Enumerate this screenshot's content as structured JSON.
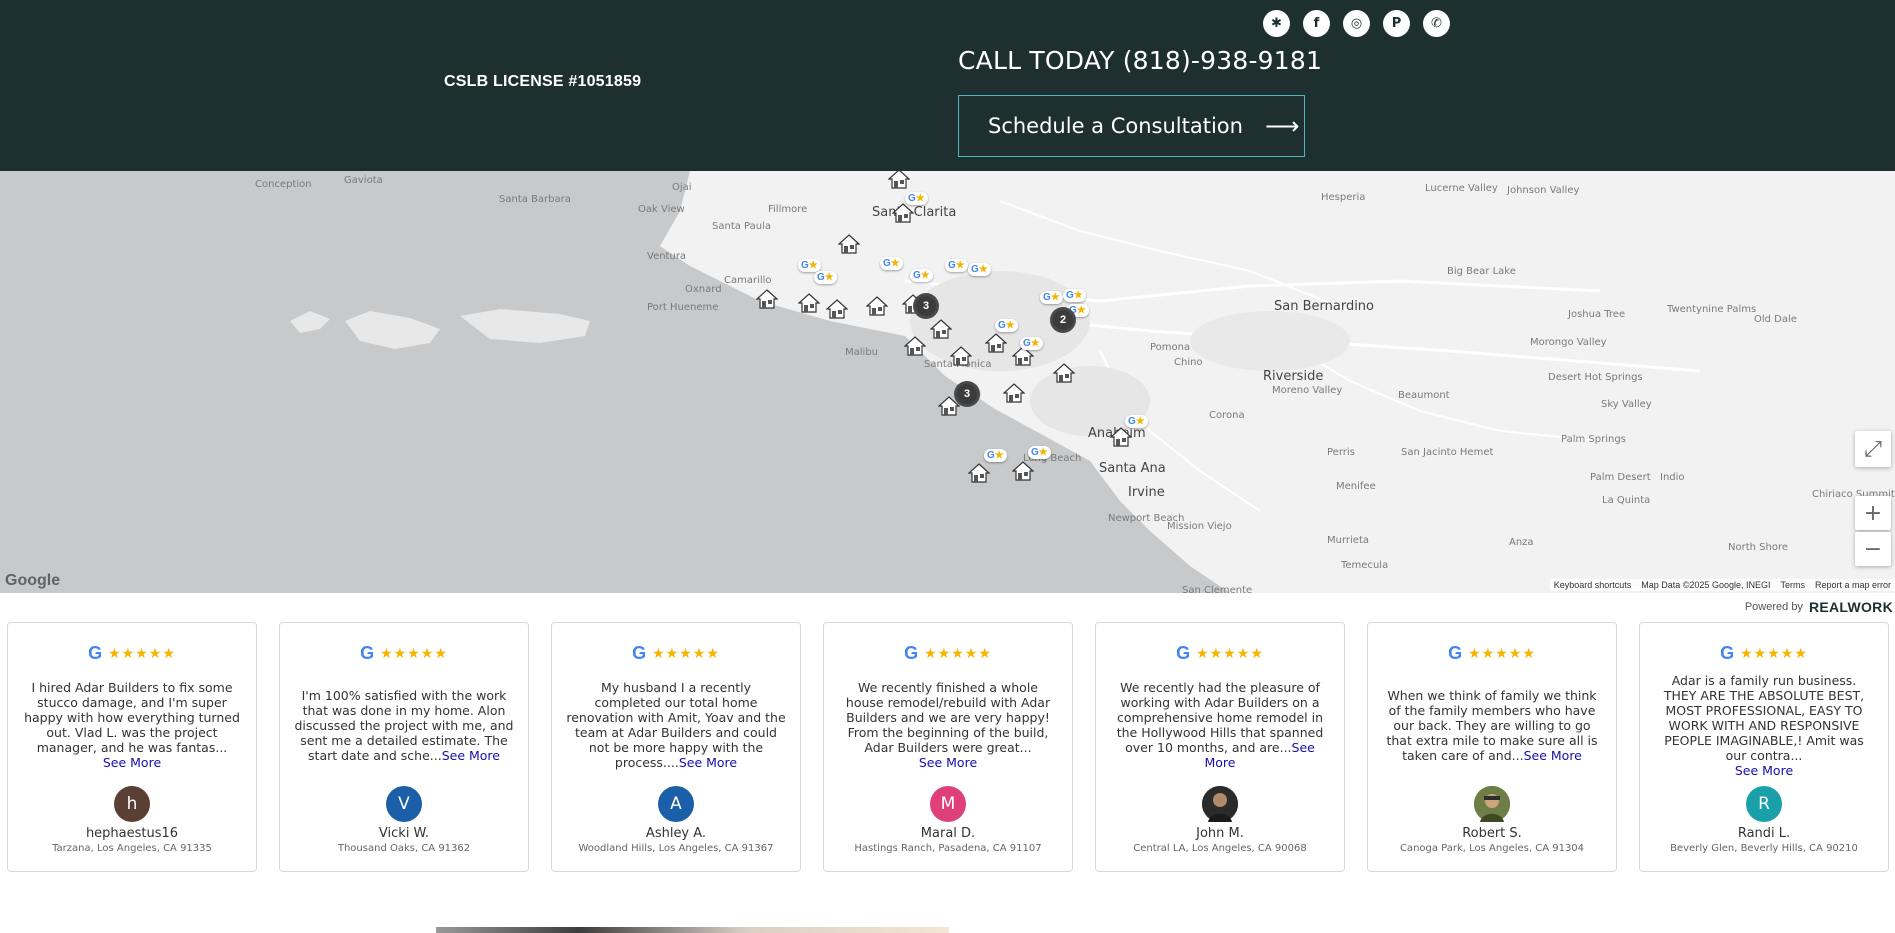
{
  "header": {
    "license": "CSLB LICENSE #1051859",
    "call": "CALL TODAY (818)-938-9181",
    "cta_label": "Schedule a Consultation",
    "cta_arrow": "⟶",
    "social": [
      {
        "name": "yelp-icon",
        "glyph": "✱"
      },
      {
        "name": "facebook-icon",
        "glyph": "f"
      },
      {
        "name": "instagram-icon",
        "glyph": "◎"
      },
      {
        "name": "pinterest-icon",
        "glyph": "P"
      },
      {
        "name": "phone-icon",
        "glyph": "✆"
      }
    ]
  },
  "map": {
    "labels": [
      {
        "text": "Conception",
        "size": "small"
      },
      {
        "text": "Gaviota",
        "size": "small"
      },
      {
        "text": "Ojai",
        "size": "small"
      },
      {
        "text": "Santa Barbara",
        "size": "small"
      },
      {
        "text": "Oak View",
        "size": "small"
      },
      {
        "text": "Fillmore",
        "size": "small"
      },
      {
        "text": "Santa Paula",
        "size": "small"
      },
      {
        "text": "Santa Clarita",
        "size": "big"
      },
      {
        "text": "Ventura",
        "size": "small"
      },
      {
        "text": "Camarillo",
        "size": "small"
      },
      {
        "text": "Oxnard",
        "size": "small"
      },
      {
        "text": "Port Hueneme",
        "size": "small"
      },
      {
        "text": "Malibu",
        "size": "small"
      },
      {
        "text": "Santa Monica",
        "size": "small"
      },
      {
        "text": "Hesperia",
        "size": "small"
      },
      {
        "text": "Lucerne Valley",
        "size": "small"
      },
      {
        "text": "Johnson Valley",
        "size": "small"
      },
      {
        "text": "Big Bear Lake",
        "size": "small"
      },
      {
        "text": "San Bernardino",
        "size": "big"
      },
      {
        "text": "Joshua Tree",
        "size": "small"
      },
      {
        "text": "Twentynine Palms",
        "size": "small"
      },
      {
        "text": "Old Dale",
        "size": "small"
      },
      {
        "text": "Morongo Valley",
        "size": "small"
      },
      {
        "text": "Pomona",
        "size": "small"
      },
      {
        "text": "Chino",
        "size": "small"
      },
      {
        "text": "Riverside",
        "size": "big"
      },
      {
        "text": "Moreno Valley",
        "size": "small"
      },
      {
        "text": "Beaumont",
        "size": "small"
      },
      {
        "text": "Desert Hot Springs",
        "size": "small"
      },
      {
        "text": "Sky Valley",
        "size": "small"
      },
      {
        "text": "Corona",
        "size": "small"
      },
      {
        "text": "Anaheim",
        "size": "big"
      },
      {
        "text": "Santa Ana",
        "size": "big"
      },
      {
        "text": "Irvine",
        "size": "big"
      },
      {
        "text": "Perris",
        "size": "small"
      },
      {
        "text": "San Jacinto Hemet",
        "size": "small"
      },
      {
        "text": "Palm Springs",
        "size": "small"
      },
      {
        "text": "Menifee",
        "size": "small"
      },
      {
        "text": "Palm Desert",
        "size": "small"
      },
      {
        "text": "Indio",
        "size": "small"
      },
      {
        "text": "Newport Beach",
        "size": "small"
      },
      {
        "text": "Mission Viejo",
        "size": "small"
      },
      {
        "text": "La Quinta",
        "size": "small"
      },
      {
        "text": "Murrieta",
        "size": "small"
      },
      {
        "text": "Anza",
        "size": "small"
      },
      {
        "text": "North Shore",
        "size": "small"
      },
      {
        "text": "Chiriaco Summit",
        "size": "small"
      },
      {
        "text": "Temecula",
        "size": "small"
      },
      {
        "text": "San Clemente",
        "size": "small"
      },
      {
        "text": "Long Beach",
        "size": "small"
      }
    ],
    "clusters": [
      "3",
      "2",
      "3"
    ],
    "google_logo": "Google",
    "footer": {
      "shortcuts": "Keyboard shortcuts",
      "data": "Map Data ©2025 Google, INEGI",
      "terms": "Terms",
      "report": "Report a map error"
    },
    "controls": {
      "fullscreen": "⤢",
      "zoom_in": "+",
      "zoom_out": "−"
    }
  },
  "powered": {
    "label": "Powered by",
    "brand": "REALWORK"
  },
  "reviews": [
    {
      "text": "I hired Adar Builders to fix some stucco damage, and I'm super happy with how everything turned out. Vlad L. was the project manager, and he was fantas...",
      "more": "See More",
      "initial": "h",
      "avatar_color": "#5a4034",
      "name": "hephaestus16",
      "location": "Tarzana, Los Angeles, CA 91335"
    },
    {
      "text": "I'm 100% satisfied with the work that was done in my home. Alon discussed the project with me, and sent me a detailed estimate. The start date and sche...",
      "more": "See More",
      "initial": "V",
      "avatar_color": "#1a5fa8",
      "name": "Vicki W.",
      "location": "Thousand Oaks, CA 91362"
    },
    {
      "text": "My husband I a recently completed our total home renovation with Amit, Yoav and the team at Adar Builders and could not be more happy with the process....",
      "more": "See More",
      "initial": "A",
      "avatar_color": "#1a5fa8",
      "name": "Ashley A.",
      "location": "Woodland Hills, Los Angeles, CA 91367"
    },
    {
      "text": "We recently finished a whole house remodel/rebuild with Adar Builders and we are very happy! From the beginning of the build, Adar Builders were great...",
      "more": "See More",
      "initial": "M",
      "avatar_color": "#e0407a",
      "name": "Maral D.",
      "location": "Hastings Ranch, Pasadena, CA 91107"
    },
    {
      "text": "We recently had the pleasure of working with Adar Builders on a comprehensive home remodel in the Hollywood Hills that spanned over 10 months, and are...",
      "more": "See More",
      "initial": "",
      "avatar_color": "#3a3a3a",
      "name": "John M.",
      "location": "Central LA, Los Angeles, CA 90068"
    },
    {
      "text": "When we think of family we think of the family members who have our back. They are willing to go that extra mile to make sure all is taken care of and...",
      "more": "See More",
      "initial": "",
      "avatar_color": "#5b6b3a",
      "name": "Robert S.",
      "location": "Canoga Park, Los Angeles, CA 91304"
    },
    {
      "text": "Adar is a family run business. THEY ARE THE ABSOLUTE BEST, MOST PROFESSIONAL, EASY TO WORK WITH AND RESPONSIVE PEOPLE IMAGINABLE,! Amit was our contra...",
      "more": "See More",
      "initial": "R",
      "avatar_color": "#1aa0a8",
      "name": "Randi L.",
      "location": "Beverly Glen, Beverly Hills, CA 90210"
    }
  ],
  "review_rating": {
    "google": "G",
    "stars": "★★★★★"
  }
}
